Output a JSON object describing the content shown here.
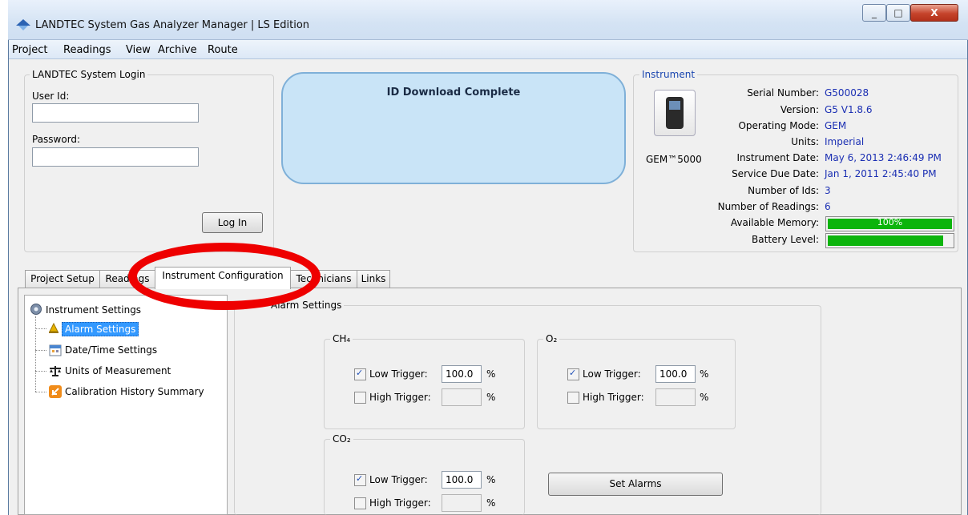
{
  "window": {
    "title": "LANDTEC System Gas Analyzer Manager | LS Edition",
    "close": "X",
    "minimize": "_",
    "maximize": "□"
  },
  "menu": [
    "Project",
    "Readings",
    "View",
    "Archive",
    "Route"
  ],
  "login": {
    "title": "LANDTEC System Login",
    "user_label": "User Id:",
    "password_label": "Password:",
    "user_value": "",
    "password_value": "",
    "button": "Log In"
  },
  "status": {
    "message": "ID Download Complete"
  },
  "instrument": {
    "title": "Instrument",
    "model": "GEM™5000",
    "fields": [
      {
        "label": "Serial Number:",
        "value": "G500028"
      },
      {
        "label": "Version:",
        "value": "G5 V1.8.6"
      },
      {
        "label": "Operating Mode:",
        "value": "GEM"
      },
      {
        "label": "Units:",
        "value": "Imperial"
      },
      {
        "label": "Instrument Date:",
        "value": "May 6, 2013 2:46:49 PM"
      },
      {
        "label": "Service Due Date:",
        "value": "Jan 1, 2011 2:45:40 PM"
      },
      {
        "label": "Number of Ids:",
        "value": "3"
      },
      {
        "label": "Number of Readings:",
        "value": "6"
      }
    ],
    "memory": {
      "label": "Available Memory:",
      "text": "100%",
      "fraction": 1.0
    },
    "battery": {
      "label": "Battery Level:",
      "fraction": 0.93
    }
  },
  "tabs": [
    "Project Setup",
    "Readings",
    "Instrument Configuration",
    "Technicians",
    "Links"
  ],
  "tree": {
    "root": "Instrument Settings",
    "children": [
      "Alarm Settings",
      "Date/Time Settings",
      "Units of Measurement",
      "Calibration History Summary"
    ]
  },
  "alarm": {
    "title": "Alarm Settings",
    "low_label": "Low Trigger:",
    "high_label": "High Trigger:",
    "unit": "%",
    "gases": [
      {
        "name": "CH₄",
        "low": "100.0",
        "high": "",
        "low_checked": true,
        "high_checked": false
      },
      {
        "name": "O₂",
        "low": "100.0",
        "high": "",
        "low_checked": true,
        "high_checked": false
      },
      {
        "name": "CO₂",
        "low": "100.0",
        "high": "",
        "low_checked": true,
        "high_checked": false
      }
    ],
    "set_button": "Set Alarms"
  },
  "colors": {
    "value_blue": "#1b2fb3",
    "bar_green": "#0cb40c",
    "highlight_red": "#ee0000",
    "status_bg": "#c9e4f7"
  }
}
